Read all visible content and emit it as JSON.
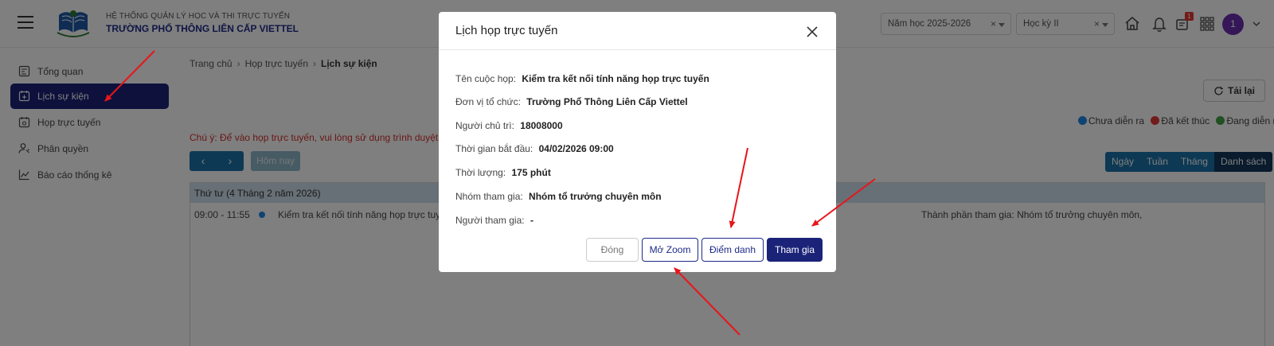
{
  "header": {
    "system_name": "HỆ THỐNG QUẢN LÝ HỌC VÀ THI TRỰC TUYẾN",
    "school_name": "TRƯỜNG PHỔ THÔNG LIÊN CẤP VIETTEL",
    "year_select": "Năm học 2025-2026",
    "semester_select": "Học kỳ II",
    "notification_count": "1",
    "avatar_initial": "1"
  },
  "sidebar": {
    "items": [
      {
        "label": "Tổng quan",
        "icon": "dashboard-icon"
      },
      {
        "label": "Lịch sự kiện",
        "icon": "calendar-icon",
        "active": true
      },
      {
        "label": "Họp trực tuyến",
        "icon": "meeting-calendar-icon"
      },
      {
        "label": "Phân quyền",
        "icon": "user-permission-icon"
      },
      {
        "label": "Báo cáo thống kê",
        "icon": "chart-line-icon"
      }
    ]
  },
  "main": {
    "breadcrumb": [
      "Trang chủ",
      "Họp trực tuyến",
      "Lịch sự kiện"
    ],
    "reload_label": "Tải lại",
    "legend": [
      {
        "label": "Chưa diễn ra",
        "color": "#1e88e5"
      },
      {
        "label": "Đã kết thúc",
        "color": "#e53935"
      },
      {
        "label": "Đang diễn ra",
        "color": "#43a047"
      }
    ],
    "note": "Chú ý: Để vào họp trực tuyến, vui lòng sử dụng trình duyệt Go",
    "today_label": "Hôm nay",
    "views": [
      "Ngày",
      "Tuần",
      "Tháng",
      "Danh sách"
    ],
    "active_view": "Danh sách",
    "day_header": "Thứ tư   (4 Tháng 2 năm 2026)",
    "event": {
      "time": "09:00 - 11:55",
      "name": "Kiểm tra kết nối tính năng họp trực tuyến",
      "participants": "Thành phần tham gia: Nhóm tổ trưởng chuyên môn,"
    }
  },
  "modal": {
    "title": "Lịch họp trực tuyến",
    "fields": [
      {
        "label": "Tên cuộc họp:",
        "value": "Kiểm tra kết nối tính năng họp trực tuyến"
      },
      {
        "label": "Đơn vị tổ chức:",
        "value": "Trường Phổ Thông Liên Cấp Viettel"
      },
      {
        "label": "Người chủ trì:",
        "value": "18008000"
      },
      {
        "label": "Thời gian bắt đầu:",
        "value": "04/02/2026 09:00"
      },
      {
        "label": "Thời lượng:",
        "value": "175 phút"
      },
      {
        "label": "Nhóm tham gia:",
        "value": "Nhóm tổ trưởng chuyên môn"
      },
      {
        "label": "Người tham gia:",
        "value": "-"
      }
    ],
    "buttons": {
      "close": "Đóng",
      "open_zoom": "Mở Zoom",
      "attendance": "Điểm danh",
      "join": "Tham gia"
    }
  },
  "colors": {
    "primary": "#1b2379",
    "accent_blue": "#1a73a8",
    "annotation_arrow": "#e8151b"
  }
}
